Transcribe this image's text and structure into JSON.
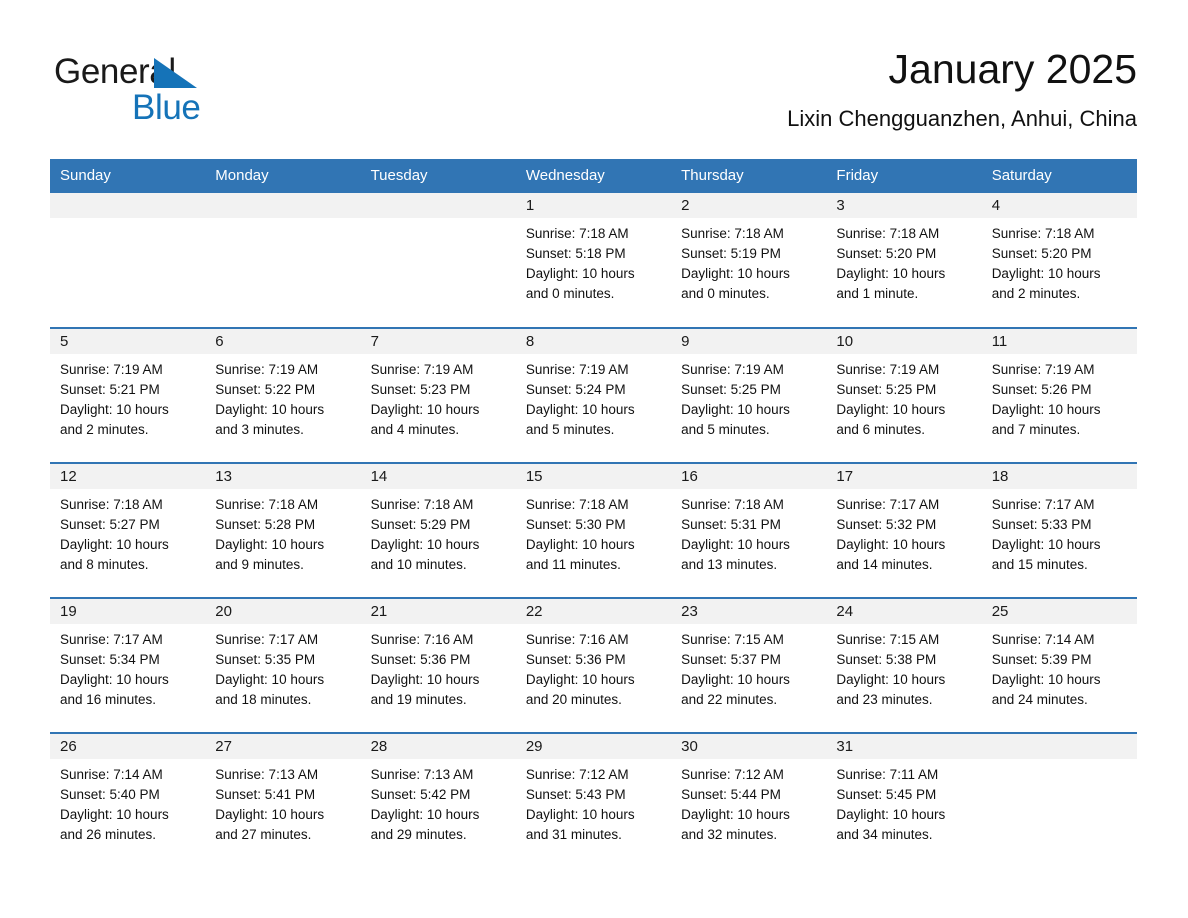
{
  "brand": {
    "line1": "General",
    "line2": "Blue",
    "triangle_color": "#1573b8",
    "text_color": "#1a1a1a"
  },
  "header": {
    "month_title": "January 2025",
    "location": "Lixin Chengguanzhen, Anhui, China",
    "header_bg": "#3175b4",
    "header_text": "#ffffff",
    "daynum_bg": "#f2f2f2"
  },
  "weekdays": [
    "Sunday",
    "Monday",
    "Tuesday",
    "Wednesday",
    "Thursday",
    "Friday",
    "Saturday"
  ],
  "weeks": [
    [
      {
        "day": "",
        "empty": true
      },
      {
        "day": "",
        "empty": true
      },
      {
        "day": "",
        "empty": true
      },
      {
        "day": "1",
        "sunrise": "Sunrise: 7:18 AM",
        "sunset": "Sunset: 5:18 PM",
        "daylight_1": "Daylight: 10 hours",
        "daylight_2": "and 0 minutes."
      },
      {
        "day": "2",
        "sunrise": "Sunrise: 7:18 AM",
        "sunset": "Sunset: 5:19 PM",
        "daylight_1": "Daylight: 10 hours",
        "daylight_2": "and 0 minutes."
      },
      {
        "day": "3",
        "sunrise": "Sunrise: 7:18 AM",
        "sunset": "Sunset: 5:20 PM",
        "daylight_1": "Daylight: 10 hours",
        "daylight_2": "and 1 minute."
      },
      {
        "day": "4",
        "sunrise": "Sunrise: 7:18 AM",
        "sunset": "Sunset: 5:20 PM",
        "daylight_1": "Daylight: 10 hours",
        "daylight_2": "and 2 minutes."
      }
    ],
    [
      {
        "day": "5",
        "sunrise": "Sunrise: 7:19 AM",
        "sunset": "Sunset: 5:21 PM",
        "daylight_1": "Daylight: 10 hours",
        "daylight_2": "and 2 minutes."
      },
      {
        "day": "6",
        "sunrise": "Sunrise: 7:19 AM",
        "sunset": "Sunset: 5:22 PM",
        "daylight_1": "Daylight: 10 hours",
        "daylight_2": "and 3 minutes."
      },
      {
        "day": "7",
        "sunrise": "Sunrise: 7:19 AM",
        "sunset": "Sunset: 5:23 PM",
        "daylight_1": "Daylight: 10 hours",
        "daylight_2": "and 4 minutes."
      },
      {
        "day": "8",
        "sunrise": "Sunrise: 7:19 AM",
        "sunset": "Sunset: 5:24 PM",
        "daylight_1": "Daylight: 10 hours",
        "daylight_2": "and 5 minutes."
      },
      {
        "day": "9",
        "sunrise": "Sunrise: 7:19 AM",
        "sunset": "Sunset: 5:25 PM",
        "daylight_1": "Daylight: 10 hours",
        "daylight_2": "and 5 minutes."
      },
      {
        "day": "10",
        "sunrise": "Sunrise: 7:19 AM",
        "sunset": "Sunset: 5:25 PM",
        "daylight_1": "Daylight: 10 hours",
        "daylight_2": "and 6 minutes."
      },
      {
        "day": "11",
        "sunrise": "Sunrise: 7:19 AM",
        "sunset": "Sunset: 5:26 PM",
        "daylight_1": "Daylight: 10 hours",
        "daylight_2": "and 7 minutes."
      }
    ],
    [
      {
        "day": "12",
        "sunrise": "Sunrise: 7:18 AM",
        "sunset": "Sunset: 5:27 PM",
        "daylight_1": "Daylight: 10 hours",
        "daylight_2": "and 8 minutes."
      },
      {
        "day": "13",
        "sunrise": "Sunrise: 7:18 AM",
        "sunset": "Sunset: 5:28 PM",
        "daylight_1": "Daylight: 10 hours",
        "daylight_2": "and 9 minutes."
      },
      {
        "day": "14",
        "sunrise": "Sunrise: 7:18 AM",
        "sunset": "Sunset: 5:29 PM",
        "daylight_1": "Daylight: 10 hours",
        "daylight_2": "and 10 minutes."
      },
      {
        "day": "15",
        "sunrise": "Sunrise: 7:18 AM",
        "sunset": "Sunset: 5:30 PM",
        "daylight_1": "Daylight: 10 hours",
        "daylight_2": "and 11 minutes."
      },
      {
        "day": "16",
        "sunrise": "Sunrise: 7:18 AM",
        "sunset": "Sunset: 5:31 PM",
        "daylight_1": "Daylight: 10 hours",
        "daylight_2": "and 13 minutes."
      },
      {
        "day": "17",
        "sunrise": "Sunrise: 7:17 AM",
        "sunset": "Sunset: 5:32 PM",
        "daylight_1": "Daylight: 10 hours",
        "daylight_2": "and 14 minutes."
      },
      {
        "day": "18",
        "sunrise": "Sunrise: 7:17 AM",
        "sunset": "Sunset: 5:33 PM",
        "daylight_1": "Daylight: 10 hours",
        "daylight_2": "and 15 minutes."
      }
    ],
    [
      {
        "day": "19",
        "sunrise": "Sunrise: 7:17 AM",
        "sunset": "Sunset: 5:34 PM",
        "daylight_1": "Daylight: 10 hours",
        "daylight_2": "and 16 minutes."
      },
      {
        "day": "20",
        "sunrise": "Sunrise: 7:17 AM",
        "sunset": "Sunset: 5:35 PM",
        "daylight_1": "Daylight: 10 hours",
        "daylight_2": "and 18 minutes."
      },
      {
        "day": "21",
        "sunrise": "Sunrise: 7:16 AM",
        "sunset": "Sunset: 5:36 PM",
        "daylight_1": "Daylight: 10 hours",
        "daylight_2": "and 19 minutes."
      },
      {
        "day": "22",
        "sunrise": "Sunrise: 7:16 AM",
        "sunset": "Sunset: 5:36 PM",
        "daylight_1": "Daylight: 10 hours",
        "daylight_2": "and 20 minutes."
      },
      {
        "day": "23",
        "sunrise": "Sunrise: 7:15 AM",
        "sunset": "Sunset: 5:37 PM",
        "daylight_1": "Daylight: 10 hours",
        "daylight_2": "and 22 minutes."
      },
      {
        "day": "24",
        "sunrise": "Sunrise: 7:15 AM",
        "sunset": "Sunset: 5:38 PM",
        "daylight_1": "Daylight: 10 hours",
        "daylight_2": "and 23 minutes."
      },
      {
        "day": "25",
        "sunrise": "Sunrise: 7:14 AM",
        "sunset": "Sunset: 5:39 PM",
        "daylight_1": "Daylight: 10 hours",
        "daylight_2": "and 24 minutes."
      }
    ],
    [
      {
        "day": "26",
        "sunrise": "Sunrise: 7:14 AM",
        "sunset": "Sunset: 5:40 PM",
        "daylight_1": "Daylight: 10 hours",
        "daylight_2": "and 26 minutes."
      },
      {
        "day": "27",
        "sunrise": "Sunrise: 7:13 AM",
        "sunset": "Sunset: 5:41 PM",
        "daylight_1": "Daylight: 10 hours",
        "daylight_2": "and 27 minutes."
      },
      {
        "day": "28",
        "sunrise": "Sunrise: 7:13 AM",
        "sunset": "Sunset: 5:42 PM",
        "daylight_1": "Daylight: 10 hours",
        "daylight_2": "and 29 minutes."
      },
      {
        "day": "29",
        "sunrise": "Sunrise: 7:12 AM",
        "sunset": "Sunset: 5:43 PM",
        "daylight_1": "Daylight: 10 hours",
        "daylight_2": "and 31 minutes."
      },
      {
        "day": "30",
        "sunrise": "Sunrise: 7:12 AM",
        "sunset": "Sunset: 5:44 PM",
        "daylight_1": "Daylight: 10 hours",
        "daylight_2": "and 32 minutes."
      },
      {
        "day": "31",
        "sunrise": "Sunrise: 7:11 AM",
        "sunset": "Sunset: 5:45 PM",
        "daylight_1": "Daylight: 10 hours",
        "daylight_2": "and 34 minutes."
      },
      {
        "day": "",
        "empty": true
      }
    ]
  ]
}
